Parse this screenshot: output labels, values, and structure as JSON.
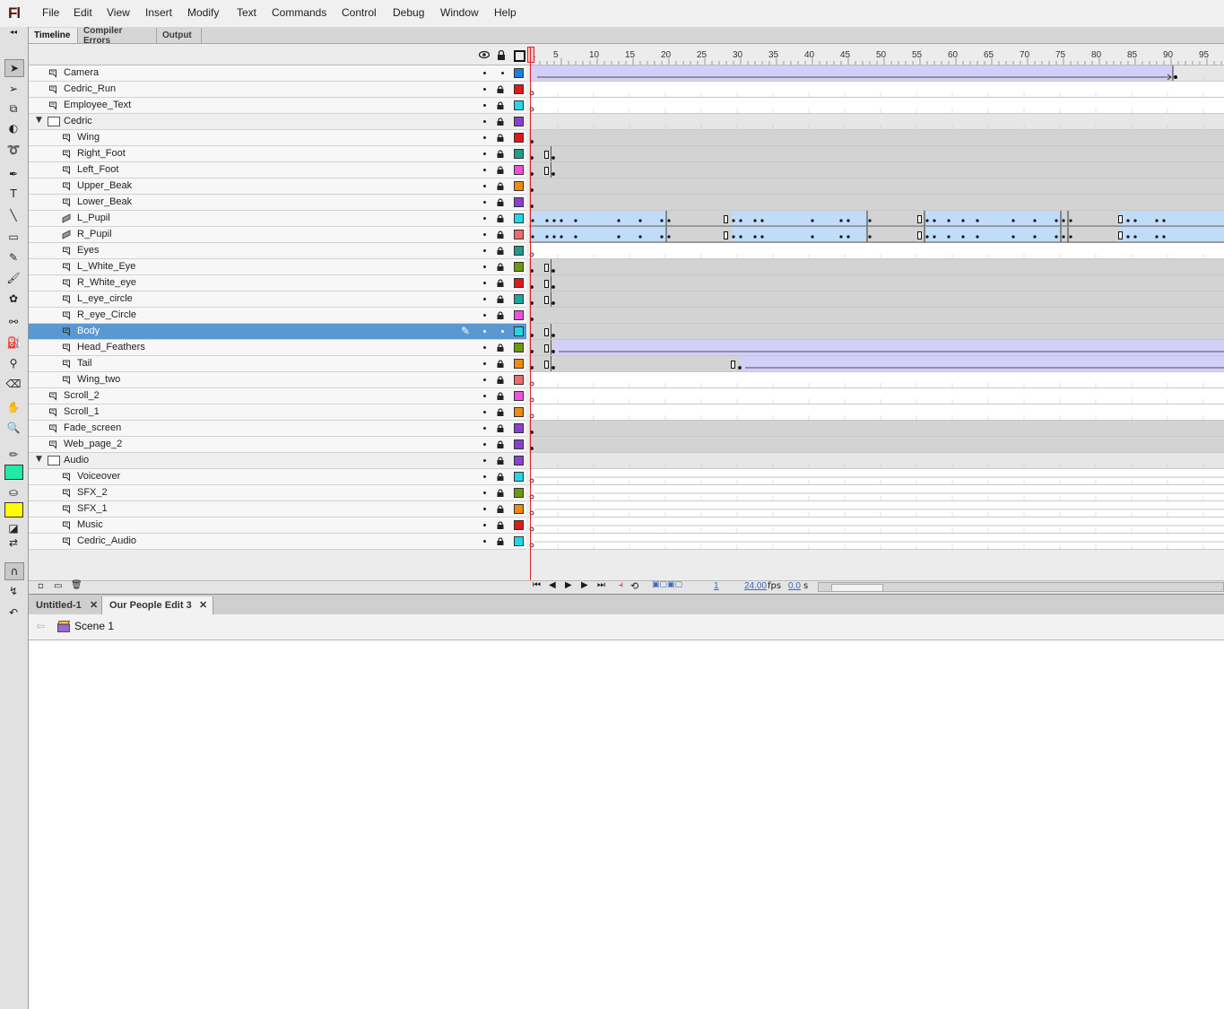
{
  "app": {
    "logo": "Fl"
  },
  "menu": [
    "File",
    "Edit",
    "View",
    "Insert",
    "Modify",
    "Text",
    "Commands",
    "Control",
    "Debug",
    "Window",
    "Help"
  ],
  "panel_tabs": [
    "Timeline",
    "Compiler Errors",
    "Output"
  ],
  "ruler_labels": [
    "1",
    "5",
    "10",
    "15",
    "20",
    "25",
    "30",
    "35",
    "40",
    "45",
    "50",
    "55",
    "60",
    "65",
    "70",
    "75",
    "80",
    "85",
    "90",
    "95"
  ],
  "layers": [
    {
      "name": "Camera",
      "indent": 0,
      "type": "layer",
      "color": "#1a7fdc"
    },
    {
      "name": "Cedric_Run",
      "indent": 0,
      "type": "layer",
      "color": "#e01818"
    },
    {
      "name": "Employee_Text",
      "indent": 0,
      "type": "layer",
      "color": "#22d8e8"
    },
    {
      "name": "Cedric",
      "indent": 0,
      "type": "folder",
      "color": "#8a3fd0"
    },
    {
      "name": "Wing",
      "indent": 1,
      "type": "layer",
      "color": "#e01818"
    },
    {
      "name": "Right_Foot",
      "indent": 1,
      "type": "layer",
      "color": "#1f9a8e"
    },
    {
      "name": "Left_Foot",
      "indent": 1,
      "type": "layer",
      "color": "#f050e0"
    },
    {
      "name": "Upper_Beak",
      "indent": 1,
      "type": "layer",
      "color": "#f08a10"
    },
    {
      "name": "Lower_Beak",
      "indent": 1,
      "type": "layer",
      "color": "#8a3fd0"
    },
    {
      "name": "L_Pupil",
      "indent": 1,
      "type": "mask",
      "color": "#22d8e8"
    },
    {
      "name": "R_Pupil",
      "indent": 1,
      "type": "mask",
      "color": "#f06a6a"
    },
    {
      "name": "Eyes",
      "indent": 1,
      "type": "layer",
      "color": "#1f9a8e"
    },
    {
      "name": "L_White_Eye",
      "indent": 1,
      "type": "layer",
      "color": "#6a9a10"
    },
    {
      "name": "R_White_eye",
      "indent": 1,
      "type": "layer",
      "color": "#e01818"
    },
    {
      "name": "L_eye_circle",
      "indent": 1,
      "type": "layer",
      "color": "#1aa89a"
    },
    {
      "name": "R_eye_Circle",
      "indent": 1,
      "type": "layer",
      "color": "#f050e0"
    },
    {
      "name": "Body",
      "indent": 1,
      "type": "layer",
      "color": "#22d8e8",
      "selected": true
    },
    {
      "name": "Head_Feathers",
      "indent": 1,
      "type": "layer",
      "color": "#6a9a10"
    },
    {
      "name": "Tail",
      "indent": 1,
      "type": "layer",
      "color": "#f08a10"
    },
    {
      "name": "Wing_two",
      "indent": 1,
      "type": "layer",
      "color": "#f06a6a"
    },
    {
      "name": "Scroll_2",
      "indent": 0,
      "type": "layer",
      "color": "#f050e0"
    },
    {
      "name": "Scroll_1",
      "indent": 0,
      "type": "layer",
      "color": "#f08a10"
    },
    {
      "name": "Fade_screen",
      "indent": 0,
      "type": "layer",
      "color": "#8a3fd0"
    },
    {
      "name": "Web_page_2",
      "indent": 0,
      "type": "layer",
      "color": "#8a3fd0"
    },
    {
      "name": "Audio",
      "indent": 0,
      "type": "folder",
      "color": "#8a3fd0"
    },
    {
      "name": "Voiceover",
      "indent": 1,
      "type": "layer",
      "color": "#22d8e8"
    },
    {
      "name": "SFX_2",
      "indent": 1,
      "type": "layer",
      "color": "#6a9a10"
    },
    {
      "name": "SFX_1",
      "indent": 1,
      "type": "layer",
      "color": "#f08a10"
    },
    {
      "name": "Music",
      "indent": 1,
      "type": "layer",
      "color": "#e01818"
    },
    {
      "name": "Cedric_Audio",
      "indent": 1,
      "type": "layer",
      "color": "#22d8e8"
    }
  ],
  "footer": {
    "frame": "1",
    "fps": "24.00",
    "fps_unit": "fps",
    "time": "0.0",
    "time_unit": "s"
  },
  "doc_tabs": [
    "Untitled-1",
    "Our People Edit 3"
  ],
  "scene": {
    "label": "Scene 1"
  },
  "colors": {
    "fill_swatch": "#22e8a8",
    "stroke_swatch": "#ffff00",
    "selection": "#5a98d1",
    "tween": "#c0dcf8",
    "playhead": "#e02020"
  }
}
